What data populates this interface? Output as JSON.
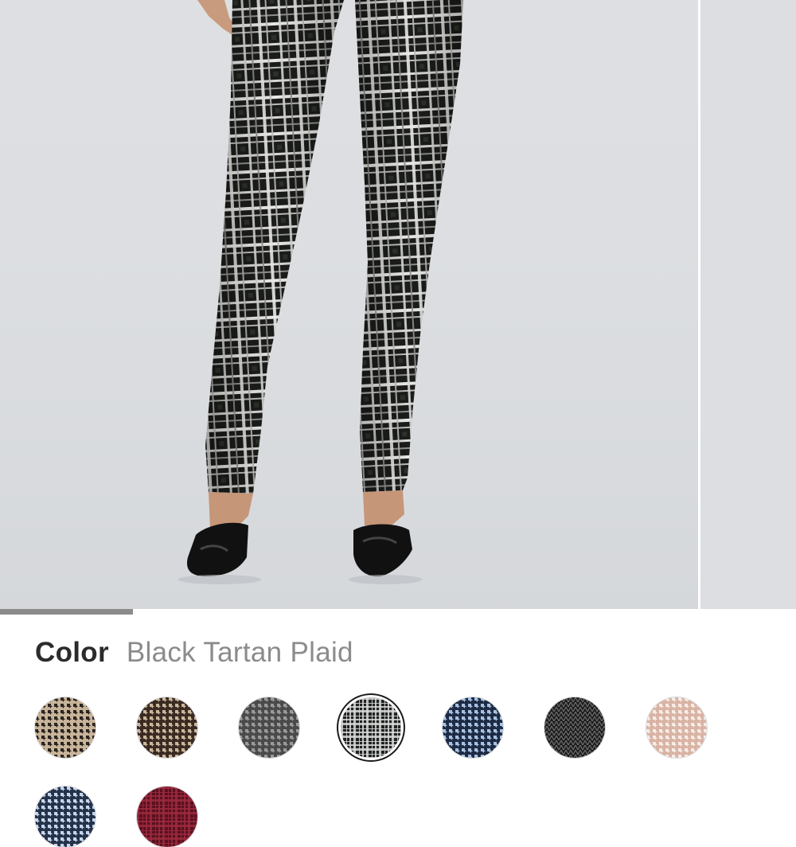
{
  "product_gallery": {
    "image_subject": "model-wearing-plaid-pants",
    "scroll_position_fraction": 0.167
  },
  "color": {
    "label": "Color",
    "selected_value": "Black Tartan Plaid"
  },
  "swatches": [
    {
      "id": "tan-houndstooth",
      "base": "#c8b49a",
      "accent": "#2a2420",
      "pattern": "houndstooth"
    },
    {
      "id": "brown-houndstooth",
      "base": "#3a2a22",
      "accent": "#c9b79d",
      "pattern": "houndstooth"
    },
    {
      "id": "grey-houndstooth",
      "base": "#4a4a4a",
      "accent": "#9a9a9a",
      "pattern": "houndstooth"
    },
    {
      "id": "black-tartan-plaid",
      "base": "#1f2420",
      "accent": "#d8d8d8",
      "pattern": "plaid",
      "selected": true
    },
    {
      "id": "blue-houndstooth",
      "base": "#1d2b44",
      "accent": "#a9c1e0",
      "pattern": "houndstooth"
    },
    {
      "id": "black-herringbone",
      "base": "#1e1e1e",
      "accent": "#777777",
      "pattern": "herringbone"
    },
    {
      "id": "blush-houndstooth",
      "base": "#d9b3a4",
      "accent": "#f6ece6",
      "pattern": "houndstooth"
    },
    {
      "id": "navy-houndstooth",
      "base": "#24324a",
      "accent": "#c7d6ea",
      "pattern": "houndstooth"
    },
    {
      "id": "burgundy-check",
      "base": "#5a1020",
      "accent": "#9a2a3c",
      "pattern": "plaid"
    }
  ],
  "colors": {
    "gallery_bg": "#dddfe2",
    "label_text": "#2b2b2b",
    "value_text": "#8b8b8b",
    "scroll_thumb": "#8a8a8a"
  }
}
